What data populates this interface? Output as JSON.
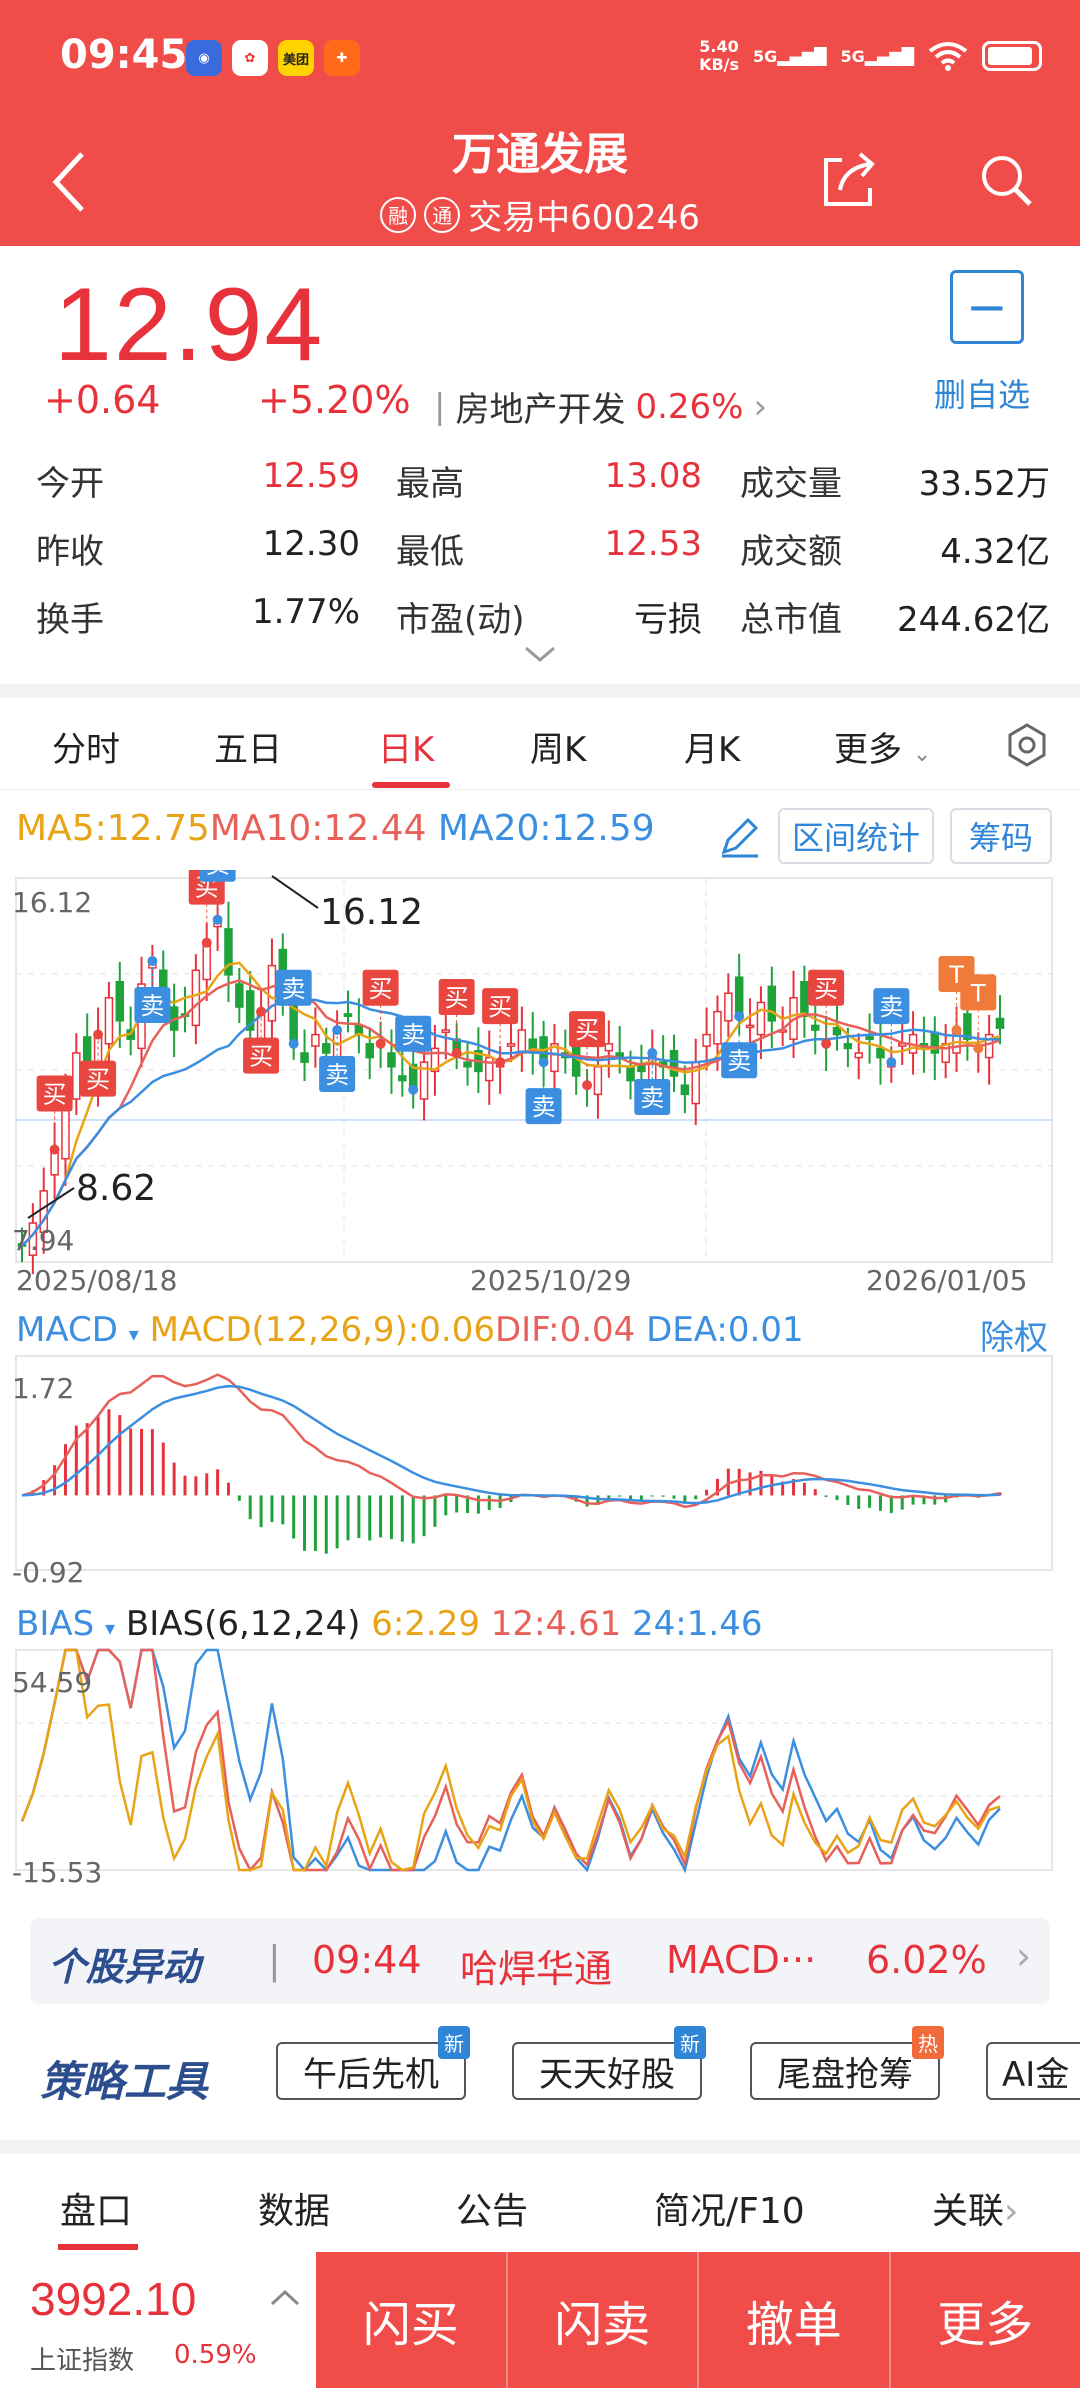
{
  "status": {
    "time": "09:45",
    "net_speed_value": "5.40",
    "net_speed_unit": "KB/s",
    "sig1": "5G",
    "sig2": "5G",
    "app_meituan": "美团"
  },
  "header": {
    "title": "万通发展",
    "badge1": "融",
    "badge2": "通",
    "status_code": "交易中600246"
  },
  "quote": {
    "price": "12.94",
    "change": "+0.64",
    "change_pct": "+5.20%",
    "industry": "房地产开发",
    "industry_pct": "0.26%",
    "watch_label": "删自选",
    "rows": [
      [
        {
          "label": "今开",
          "value": "12.59",
          "color": "red"
        },
        {
          "label": "最高",
          "value": "13.08",
          "color": "red"
        },
        {
          "label": "成交量",
          "value": "33.52万",
          "color": "black"
        }
      ],
      [
        {
          "label": "昨收",
          "value": "12.30",
          "color": "black"
        },
        {
          "label": "最低",
          "value": "12.53",
          "color": "red"
        },
        {
          "label": "成交额",
          "value": "4.32亿",
          "color": "black"
        }
      ],
      [
        {
          "label": "换手",
          "value": "1.77%",
          "color": "black"
        },
        {
          "label": "市盈(动)",
          "value": "亏损",
          "color": "black"
        },
        {
          "label": "总市值",
          "value": "244.62亿",
          "color": "black"
        }
      ]
    ]
  },
  "period_tabs": [
    "分时",
    "五日",
    "日K",
    "周K",
    "月K",
    "更多"
  ],
  "active_period": "日K",
  "ma": {
    "ma5": "MA5:12.75",
    "ma10": "MA10:12.44",
    "ma20": "MA20:12.59",
    "range_btn": "区间统计",
    "chip_btn": "筹码"
  },
  "kline": {
    "ymax_label": "16.12",
    "ymin_label": "7.94",
    "high_mark": "16.12",
    "low_mark": "8.62",
    "dates": [
      "2025/08/18",
      "2025/10/29",
      "2026/01/05"
    ],
    "buy": "买",
    "sell": "卖",
    "t": "T"
  },
  "macd": {
    "name": "MACD",
    "value": "MACD(12,26,9):0.06",
    "dif": "DIF:0.04",
    "dea": "DEA:0.01",
    "adj": "除权",
    "ymax": "1.72",
    "ymin": "-0.92"
  },
  "bias": {
    "name": "BIAS",
    "label": "BIAS(6,12,24)",
    "b6": "6:2.29",
    "b12": "12:4.61",
    "b24": "24:1.46",
    "ymax": "54.59",
    "ymin": "-15.53"
  },
  "anomaly": {
    "logo": "个股异动",
    "time": "09:44",
    "stock": "哈焊华通",
    "indicator": "MACD···",
    "pct": "6.02%"
  },
  "tools": {
    "logo": "策略工具",
    "items": [
      {
        "label": "午后先机",
        "tag": "新"
      },
      {
        "label": "天天好股",
        "tag": "新"
      },
      {
        "label": "尾盘抢筹",
        "tag": "热"
      },
      {
        "label": "AI金",
        "tag": ""
      }
    ]
  },
  "bottom_tabs": [
    "盘口",
    "数据",
    "公告",
    "简况/F10",
    "关联"
  ],
  "footer": {
    "index_value": "3992.10",
    "index_name": "上证指数",
    "index_pct": "0.59%",
    "actions": [
      "闪买",
      "闪卖",
      "撤单",
      "更多"
    ]
  },
  "chart_data": [
    {
      "type": "candlestick",
      "title": "",
      "x_range": [
        "2025/08/18",
        "2026/01/05"
      ],
      "ylim": [
        7.94,
        16.12
      ],
      "max_marker": 16.12,
      "min_marker": 8.62,
      "ma": {
        "MA5": 12.75,
        "MA10": 12.44,
        "MA20": 12.59
      },
      "close": [
        8.2,
        8.7,
        9.4,
        10.3,
        11.6,
        12.4,
        11.9,
        12.8,
        13.6,
        13.1,
        12.7,
        13.9,
        14.4,
        13.6,
        12.9,
        13.2,
        14.2,
        14.8,
        15.3,
        14.1,
        13.4,
        12.9,
        13.3,
        14.3,
        13.8,
        12.6,
        12.2,
        12.8,
        12.4,
        12.9,
        13.2,
        12.8,
        12.3,
        12.6,
        12.1,
        11.8,
        11.6,
        12.2,
        12.5,
        12.9,
        12.4,
        12.1,
        12.0,
        12.3,
        12.2,
        12.6,
        12.9,
        12.4,
        12.2,
        12.6,
        12.3,
        11.9,
        11.7,
        12.1,
        12.6,
        12.3,
        11.8,
        12.0,
        12.4,
        12.1,
        11.9,
        11.5,
        12.2,
        12.8,
        13.3,
        13.7,
        13.2,
        13.0,
        13.5,
        13.1,
        12.9,
        13.6,
        13.2,
        12.9,
        12.6,
        12.8,
        12.5,
        12.4,
        12.7,
        12.3,
        12.2,
        12.6,
        12.8,
        12.5,
        12.4,
        12.6,
        12.9,
        12.7,
        12.5,
        12.8,
        12.94
      ]
    },
    {
      "type": "bar",
      "title": "MACD(12,26,9)",
      "ylim": [
        -0.92,
        1.72
      ],
      "series": [
        {
          "name": "DIF",
          "last": 0.04
        },
        {
          "name": "DEA",
          "last": 0.01
        },
        {
          "name": "MACD",
          "last": 0.06
        }
      ]
    },
    {
      "type": "line",
      "title": "BIAS(6,12,24)",
      "ylim": [
        -15.53,
        54.59
      ],
      "series": [
        {
          "name": "6",
          "last": 2.29
        },
        {
          "name": "12",
          "last": 4.61
        },
        {
          "name": "24",
          "last": 1.46
        }
      ]
    }
  ]
}
